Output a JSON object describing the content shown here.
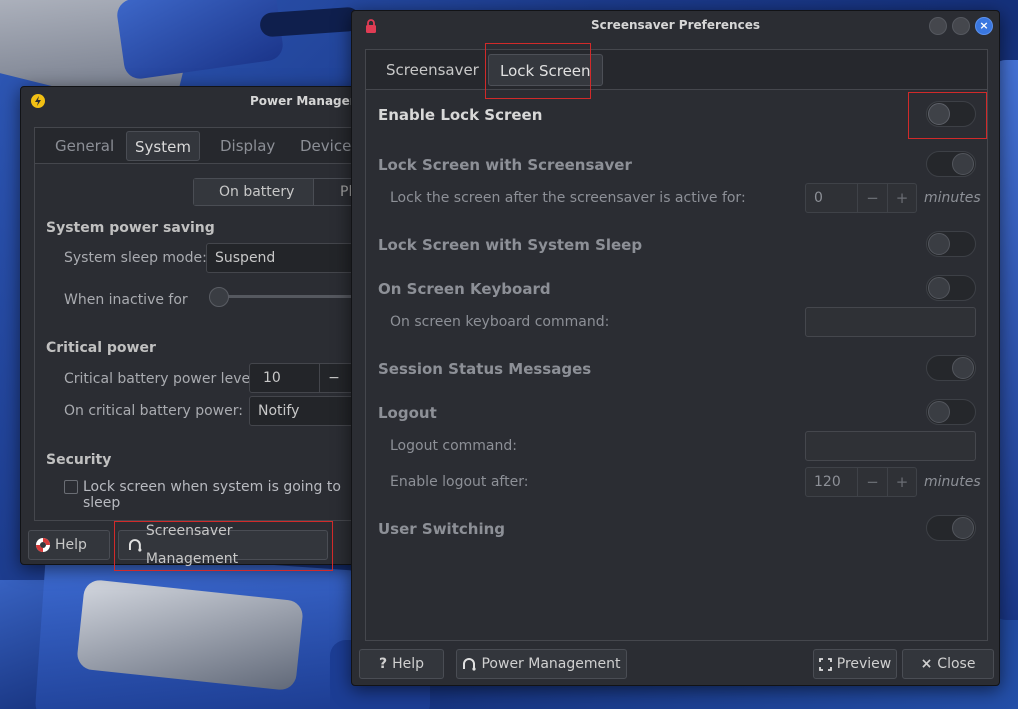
{
  "power_manager": {
    "title": "Power Manager",
    "tabs": [
      "General",
      "System",
      "Display",
      "Devices"
    ],
    "active_tab": "System",
    "segment": {
      "on_battery": "On battery",
      "plugged_in": "Pl"
    },
    "system_power_saving": {
      "heading": "System power saving",
      "sleep_mode_label": "System sleep mode:",
      "sleep_mode_value": "Suspend",
      "inactive_label": "When inactive for",
      "slider_position": 0
    },
    "critical_power": {
      "heading": "Critical power",
      "level_label": "Critical battery power level:",
      "level_value": "10",
      "level_minus": "−",
      "action_label": "On critical battery power:",
      "action_value": "Notify"
    },
    "security": {
      "heading": "Security",
      "lock_label": "Lock screen when system is going to sleep",
      "lock_checked": false
    },
    "buttons": {
      "help": "Help",
      "screensaver_management": "Screensaver Management"
    }
  },
  "screensaver_prefs": {
    "title": "Screensaver Preferences",
    "tabs": [
      "Screensaver",
      "Lock Screen"
    ],
    "active_tab": "Lock Screen",
    "rows": {
      "enable_lock": {
        "label": "Enable Lock Screen",
        "state": "off"
      },
      "lock_with_screensaver": {
        "label": "Lock Screen with Screensaver",
        "state": "on"
      },
      "lock_after_label": "Lock the screen after the screensaver is active for:",
      "lock_after_value": "0",
      "lock_after_units": "minutes",
      "lock_with_sleep": {
        "label": "Lock Screen with System Sleep",
        "state": "off"
      },
      "osk": {
        "label": "On Screen Keyboard",
        "state": "off"
      },
      "osk_command_label": "On screen keyboard command:",
      "osk_command_value": "",
      "session_status": {
        "label": "Session Status Messages",
        "state": "on"
      },
      "logout": {
        "label": "Logout",
        "state": "off"
      },
      "logout_command_label": "Logout command:",
      "logout_command_value": "",
      "logout_after_label": "Enable logout after:",
      "logout_after_value": "120",
      "logout_after_units": "minutes",
      "user_switching": {
        "label": "User Switching",
        "state": "on"
      }
    },
    "spin_minus": "−",
    "spin_plus": "+",
    "buttons": {
      "help": "Help",
      "help_prefix": "?",
      "power_management": "Power Management",
      "preview": "Preview",
      "close": "Close",
      "close_prefix": "×"
    }
  },
  "colors": {
    "accent": "#3a77e0",
    "highlight": "#d12a2a",
    "window_bg": "#2b2d33"
  }
}
